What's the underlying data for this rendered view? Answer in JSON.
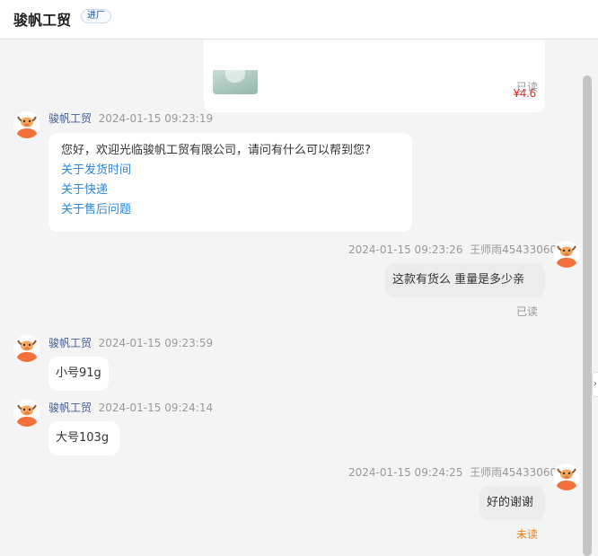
{
  "header": {
    "shop_name": "骏帆工贸",
    "tag": "进厂"
  },
  "product_card": {
    "price": "¥4.6"
  },
  "status": {
    "read": "已读",
    "unread": "未读"
  },
  "messages": [
    {
      "sender": "骏帆工贸",
      "time": "2024-01-15 09:23:19",
      "lines": [
        "您好，欢迎光临骏帆工贸有限公司，请问有什么可以帮到您?"
      ],
      "links": [
        "关于发货时间",
        "关于快递",
        "关于售后问题"
      ]
    },
    {
      "sender": "王师雨45433060",
      "time": "2024-01-15 09:23:26",
      "text": "这款有货么  重量是多少亲"
    },
    {
      "sender": "骏帆工贸",
      "time": "2024-01-15 09:23:59",
      "text": "小号91g"
    },
    {
      "sender": "骏帆工贸",
      "time": "2024-01-15 09:24:14",
      "text": "大号103g"
    },
    {
      "sender": "王师雨45433060",
      "time": "2024-01-15 09:24:25",
      "text": "好的谢谢"
    }
  ],
  "icons": {
    "avatar": "cartoon-bull-avatar-icon",
    "expand": "chevron-right-icon"
  },
  "colors": {
    "link": "#2d86d8",
    "price": "#e2231a",
    "unread": "#f07c12",
    "sender": "#3d5a96"
  }
}
